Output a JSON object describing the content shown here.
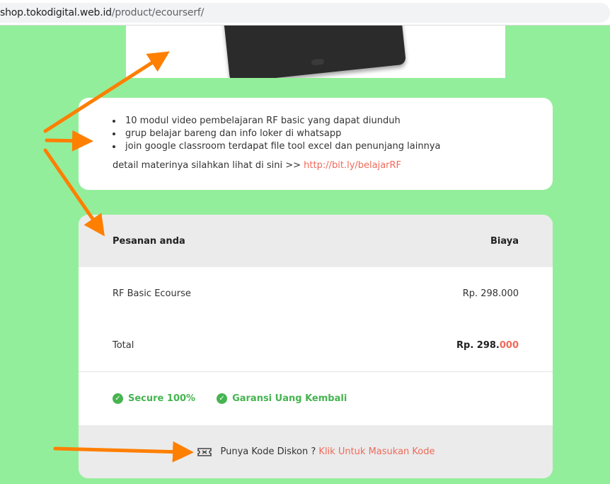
{
  "browser": {
    "url_host": "shop.tokodigital.web.id",
    "url_path": "/product/ecourserf/"
  },
  "description": {
    "bullets": [
      "10 modul video pembelajaran RF basic yang dapat diunduh",
      "grup belajar bareng dan info loker di whatsapp",
      "join google classroom terdapat file tool excel dan penunjang lainnya"
    ],
    "detail_text": "detail materinya silahkan lihat di sini >> ",
    "detail_link": "http://bit.ly/belajarRF"
  },
  "order": {
    "header_left": "Pesanan anda",
    "header_right": "Biaya",
    "item_name": "RF Basic Ecourse",
    "item_price": "Rp. 298.000",
    "total_label": "Total",
    "total_main": "Rp. 298.",
    "total_cents": "000",
    "badges": [
      "Secure 100%",
      "Garansi Uang Kembali"
    ],
    "coupon_text": "Punya Kode Diskon ? ",
    "coupon_link": "Klik Untuk Masukan Kode"
  },
  "colors": {
    "background": "#93ee9b",
    "accent_link": "#f06a5a",
    "secure_green": "#46b450",
    "annotation_arrow": "#ff7f00"
  },
  "icons": [
    "check-circle-icon",
    "coupon-ticket-icon",
    "annotation-arrow"
  ]
}
